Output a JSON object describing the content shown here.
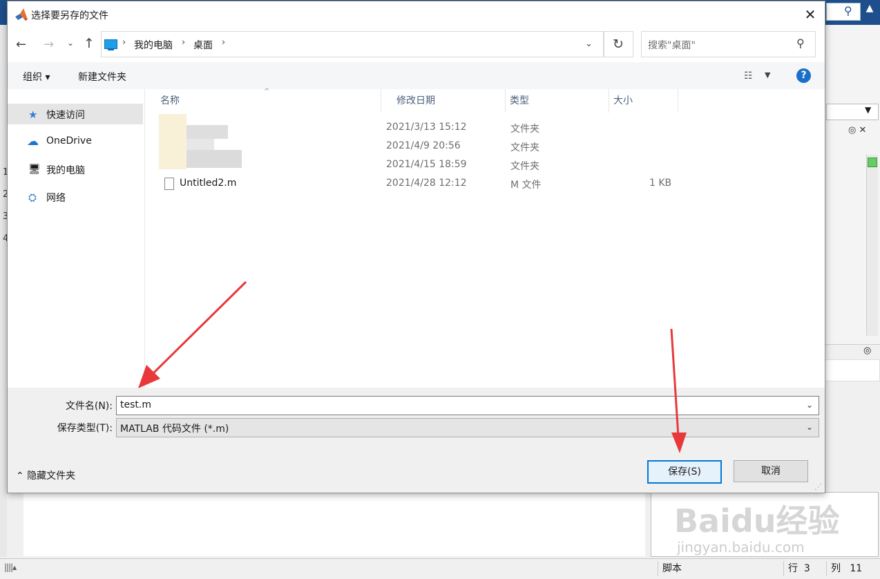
{
  "dialog": {
    "title": "选择要另存的文件",
    "close_icon": "✕"
  },
  "nav": {
    "back_icon": "←",
    "forward_icon": "→",
    "recent_icon": "⌄",
    "up_icon": "↑",
    "breadcrumb": [
      "我的电脑",
      "桌面"
    ],
    "refresh_icon": "↻",
    "search_placeholder": "搜索\"桌面\"",
    "search_icon": "⚲"
  },
  "toolbar": {
    "organize_label": "组织 ▾",
    "new_folder_label": "新建文件夹",
    "help_label": "?"
  },
  "sidebar": {
    "items": [
      {
        "label": "快速访问",
        "icon": "★"
      },
      {
        "label": "OneDrive",
        "icon": "☁"
      },
      {
        "label": "我的电脑",
        "icon": "🖥"
      },
      {
        "label": "网络",
        "icon": "⛭"
      }
    ]
  },
  "file_list": {
    "columns": [
      "名称",
      "修改日期",
      "类型",
      "大小"
    ],
    "rows": [
      {
        "name": "",
        "modified": "2021/3/13 15:12",
        "type": "文件夹",
        "size": ""
      },
      {
        "name": "",
        "modified": "2021/4/9 20:56",
        "type": "文件夹",
        "size": ""
      },
      {
        "name": "",
        "modified": "2021/4/15 18:59",
        "type": "文件夹",
        "size": ""
      },
      {
        "name": "Untitled2.m",
        "modified": "2021/4/28 12:12",
        "type": "M 文件",
        "size": "1 KB"
      }
    ]
  },
  "form": {
    "filename_label": "文件名(N):",
    "filename_value": "test.m",
    "filetype_label": "保存类型(T):",
    "filetype_value": "MATLAB 代码文件 (*.m)",
    "hide_folders_label": "隐藏文件夹",
    "save_label": "保存(S)",
    "cancel_label": "取消"
  },
  "background": {
    "line_numbers": [
      "1",
      "2",
      "3",
      "4"
    ],
    "status_mode": "脚本",
    "status_row_label": "行",
    "status_row": "3",
    "status_col_label": "列",
    "status_col": "11"
  },
  "watermark": {
    "brand": "Baidu经验",
    "url": "jingyan.baidu.com"
  },
  "colors": {
    "accent": "#0078d7",
    "arrow_red": "#e8383a",
    "matlab_blue": "#1e4f8c"
  }
}
